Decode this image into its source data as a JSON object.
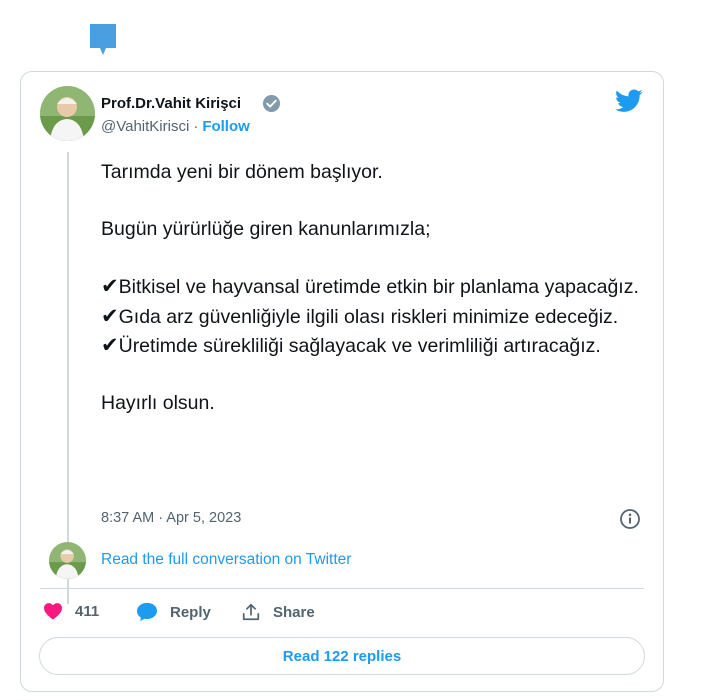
{
  "author": {
    "name": "Prof.Dr.Vahit Kirişci",
    "handle": "@VahitKirisci",
    "separator": "·",
    "follow_label": "Follow"
  },
  "tweet": {
    "line1": "Tarımda yeni bir dönem başlıyor.",
    "line2": "Bugün yürürlüğe giren kanunlarımızla;",
    "check_glyph": "✔",
    "item1": "Bitkisel ve hayvansal üretimde etkin bir planlama yapacağız.",
    "item2": "Gıda arz güvenliğiyle ilgili olası riskleri minimize edeceğiz.",
    "item3": "Üretimde sürekliliği sağlayacak ve verimliliği artıracağız.",
    "closing": "Hayırlı olsun."
  },
  "timestamp": "8:37 AM · Apr 5, 2023",
  "read_conversation": "Read the full conversation on Twitter",
  "actions": {
    "like_count": "411",
    "reply_label": "Reply",
    "share_label": "Share"
  },
  "read_replies": "Read 122 replies",
  "colors": {
    "brand_blue": "#1d9bf0",
    "like_pink": "#f91880",
    "muted_text": "#536471",
    "border": "#cfd9de"
  },
  "icons": [
    "flag-icon",
    "verified-icon",
    "twitter-bird-icon",
    "info-icon",
    "heart-icon",
    "reply-bubble-icon",
    "share-icon"
  ]
}
